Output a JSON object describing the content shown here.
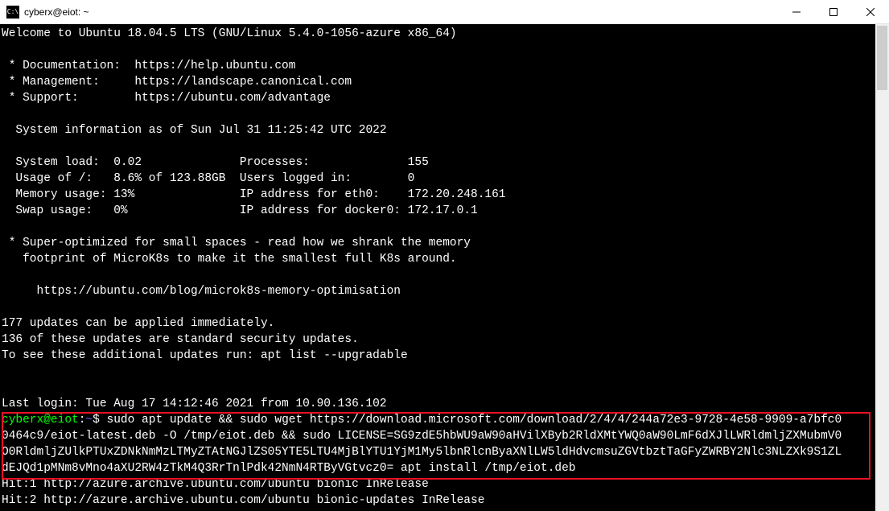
{
  "window": {
    "icon_label": "C:\\",
    "title": "cyberx@eiot: ~"
  },
  "terminal": {
    "welcome": "Welcome to Ubuntu 18.04.5 LTS (GNU/Linux 5.4.0-1056-azure x86_64)",
    "links": {
      "doc": " * Documentation:  https://help.ubuntu.com",
      "mgmt": " * Management:     https://landscape.canonical.com",
      "support": " * Support:        https://ubuntu.com/advantage"
    },
    "sysinfo_header": "  System information as of Sun Jul 31 11:25:42 UTC 2022",
    "sysinfo": {
      "l1": "  System load:  0.02              Processes:              155",
      "l2": "  Usage of /:   8.6% of 123.88GB  Users logged in:        0",
      "l3": "  Memory usage: 13%               IP address for eth0:    172.20.248.161",
      "l4": "  Swap usage:   0%                IP address for docker0: 172.17.0.1"
    },
    "blurb": {
      "l1": " * Super-optimized for small spaces - read how we shrank the memory",
      "l2": "   footprint of MicroK8s to make it the smallest full K8s around.",
      "l3": "     https://ubuntu.com/blog/microk8s-memory-optimisation"
    },
    "updates": {
      "l1": "177 updates can be applied immediately.",
      "l2": "136 of these updates are standard security updates.",
      "l3": "To see these additional updates run: apt list --upgradable"
    },
    "lastlogin": "Last login: Tue Aug 17 14:12:46 2021 from 10.90.136.102",
    "prompt": {
      "userhost": "cyberx@eiot",
      "sep": ":",
      "path": "~",
      "dollar": "$ "
    },
    "command": {
      "l1": "sudo apt update && sudo wget https://download.microsoft.com/download/2/4/4/244a72e3-9728-4e58-9909-a7bfc0",
      "l2": "0464c9/eiot-latest.deb -O /tmp/eiot.deb && sudo LICENSE=SG9zdE5hbWU9aW90aHVilXByb2RldXMtYWQ0aW90LmF6dXJlLWRldmljZXMubmV0",
      "l3": "O0RldmljZUlkPTUxZDNkNmMzLTMyZTAtNGJlZS05YTE5LTU4MjBlYTU1YjM1My5lbnRlcnByaXNlLW5ldHdvcmsuZGVtbztTaGFyZWRBY2Nlc3NLZXk9S1ZL",
      "l4": "dEJQd1pMNm8vMno4aXU2RW4zTkM4Q3RrTnlPdk42NmN4RTByVGtvcz0= apt install /tmp/eiot.deb"
    },
    "output": {
      "l1": "Hit:1 http://azure.archive.ubuntu.com/ubuntu bionic InRelease",
      "l2": "Hit:2 http://azure.archive.ubuntu.com/ubuntu bionic-updates InRelease"
    }
  }
}
